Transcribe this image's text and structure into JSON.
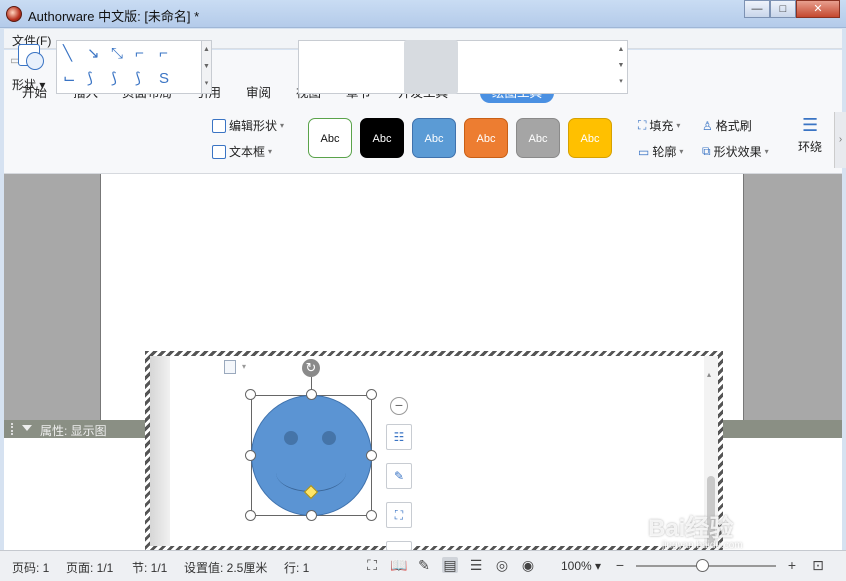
{
  "window": {
    "title": "Authorware 中文版: [未命名] *",
    "minimize": "—",
    "maximize": "□",
    "close": "✕"
  },
  "menubar": {
    "file": "文件(F)"
  },
  "tabs": [
    "开始",
    "插入",
    "页面布局",
    "引用",
    "审阅",
    "视图",
    "章节",
    "开发工具",
    "绘图工具"
  ],
  "active_tab": "绘图工具",
  "ribbon": {
    "shape_label": "形状",
    "edit_shape": "编辑形状",
    "textbox": "文本框",
    "style_swatches": [
      {
        "label": "Abc",
        "bg": "#ffffff",
        "fg": "#111111",
        "border": "#5aa34a"
      },
      {
        "label": "Abc",
        "bg": "#000000",
        "fg": "#ffffff",
        "border": "#000000"
      },
      {
        "label": "Abc",
        "bg": "#5b9bd5",
        "fg": "#ffffff",
        "border": "#3f72ad"
      },
      {
        "label": "Abc",
        "bg": "#ed7d31",
        "fg": "#ffffff",
        "border": "#c85f16"
      },
      {
        "label": "Abc",
        "bg": "#a5a5a5",
        "fg": "#ffffff",
        "border": "#8a8a8a"
      },
      {
        "label": "Abc",
        "bg": "#ffc000",
        "fg": "#ffffff",
        "border": "#d6a100"
      }
    ],
    "fill": "填充",
    "outline": "轮廓",
    "format_painter": "格式刷",
    "shape_effects": "形状效果",
    "wrap": "环绕"
  },
  "properties_panel": {
    "label": "属性: 显示图"
  },
  "statusbar": {
    "page_code": "页码: 1",
    "page": "页面: 1/1",
    "section": "节: 1/1",
    "setting": "设置值: 2.5厘米",
    "row": "行: 1",
    "zoom": "100%",
    "zoom_level": 0.47
  },
  "watermark": {
    "brand": "Bai经验",
    "site": "jingyan.baidu.com"
  },
  "colors": {
    "accent": "#4a90e2",
    "shape_fill": "#5b94d3"
  }
}
